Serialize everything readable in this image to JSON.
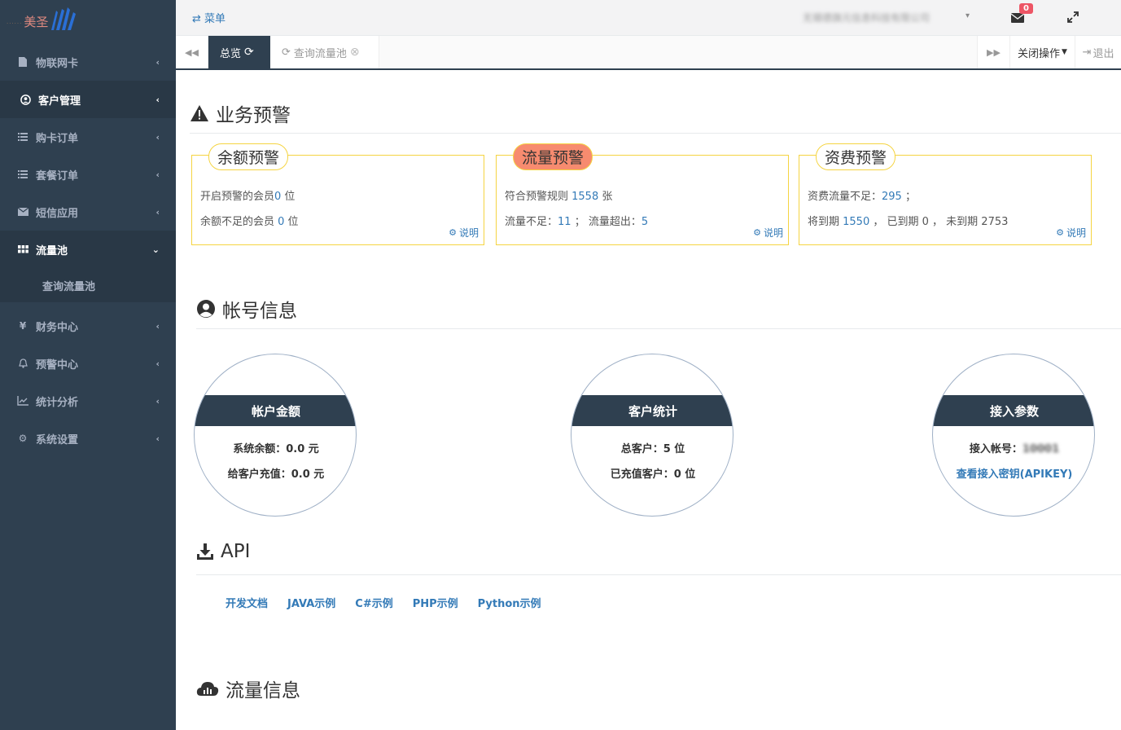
{
  "logo": {
    "dots": "......",
    "brand": "美圣"
  },
  "sidebar": {
    "items": [
      {
        "label": "物联网卡",
        "icon": "sim-card-icon"
      },
      {
        "label": "客户管理",
        "icon": "user-circle-icon"
      },
      {
        "label": "购卡订单",
        "icon": "list-icon"
      },
      {
        "label": "套餐订单",
        "icon": "list-icon"
      },
      {
        "label": "短信应用",
        "icon": "envelope-icon"
      },
      {
        "label": "流量池",
        "icon": "grid-icon"
      },
      {
        "label": "财务中心",
        "icon": "yen-icon"
      },
      {
        "label": "预警中心",
        "icon": "bell-icon"
      },
      {
        "label": "统计分析",
        "icon": "chart-line-icon"
      },
      {
        "label": "系统设置",
        "icon": "gear-icon"
      }
    ],
    "submenu": {
      "label": "查询流量池"
    }
  },
  "topbar": {
    "menu_label": "菜单",
    "company": "无锡德旗元信息科技有限公司",
    "mail_badge": "0"
  },
  "tabs": {
    "active_label": "总览",
    "inactive_label": "查询流量池",
    "close_ops_label": "关闭操作",
    "logout_label": "退出"
  },
  "business_alert": {
    "title": "业务预警",
    "balance": {
      "title": "余额预警",
      "line1_prefix": "开启预警的会员",
      "line1_value": "0",
      "line1_suffix": " 位",
      "line2_prefix": "余额不足的会员 ",
      "line2_value": "0",
      "line2_suffix": " 位",
      "explain": "说明"
    },
    "traffic": {
      "title": "流量预警",
      "line1_prefix": "符合预警规则 ",
      "line1_value": "1558",
      "line1_suffix": " 张",
      "line2_prefix1": "流量不足：",
      "line2_value1": "11",
      "line2_mid": " ； 流量超出：",
      "line2_value2": "5",
      "explain": "说明"
    },
    "fee": {
      "title": "资费预警",
      "line1_prefix": "资费流量不足：",
      "line1_value": "295",
      "line1_suffix": " ；",
      "line2_prefix": "将到期 ",
      "line2_value1": "1550",
      "line2_mid": " ， 已到期 0 ， 未到期 2753",
      "explain": "说明"
    }
  },
  "account": {
    "title": "帐号信息",
    "balance": {
      "title": "帐户金额",
      "line1": "系统余额：0.0 元",
      "line2": "给客户充值：0.0 元"
    },
    "customers": {
      "title": "客户统计",
      "line1": "总客户：5 位",
      "line2": "已充值客户：0 位"
    },
    "access": {
      "title": "接入参数",
      "line1_prefix": "接入帐号：",
      "line1_value": "10001",
      "link": "查看接入密钥(APIKEY)"
    }
  },
  "api": {
    "title": "API",
    "links": [
      "开发文档",
      "JAVA示例",
      "C#示例",
      "PHP示例",
      "Python示例"
    ]
  },
  "traffic_info": {
    "title": "流量信息"
  },
  "colors": {
    "sidebar": "#2f4050",
    "link": "#337ab7",
    "alert_border": "#f5d442",
    "hot": "#f78b6f"
  }
}
